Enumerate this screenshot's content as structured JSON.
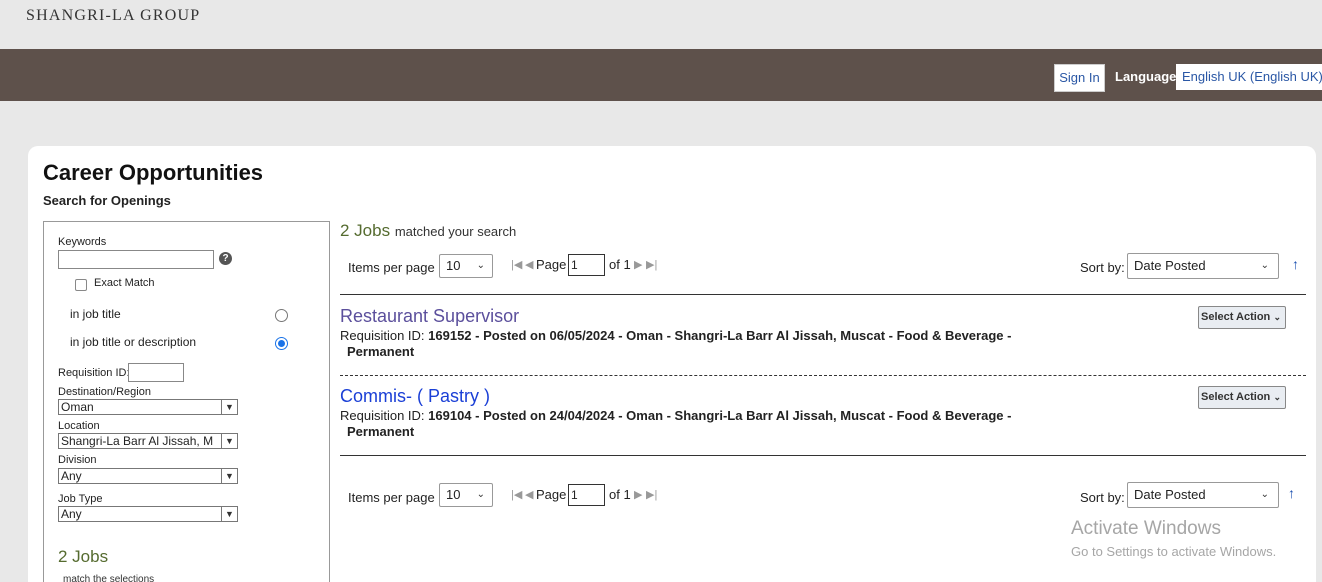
{
  "header": {
    "logo_text": "SHANGRI-LA GROUP",
    "sign_in_label": "Sign In",
    "language_label": "Language",
    "language_value": "English UK (English UK)"
  },
  "page": {
    "title": "Career Opportunities",
    "subtitle": "Search for Openings"
  },
  "filters": {
    "keywords_label": "Keywords",
    "keywords_value": "",
    "exact_match_label": "Exact Match",
    "in_job_title_label": "in job title",
    "in_job_title_or_description_label": "in job title or description",
    "requisition_id_label": "Requisition ID:",
    "requisition_id_value": "",
    "destination_label": "Destination/Region",
    "destination_value": "Oman",
    "location_label": "Location",
    "location_value": "Shangri-La Barr Al Jissah, M",
    "division_label": "Division",
    "division_value": "Any",
    "job_type_label": "Job Type",
    "job_type_value": "Any",
    "count_text": "2 Jobs",
    "count_sub": "match the selections"
  },
  "results": {
    "count_number": "2 Jobs",
    "count_suffix": "matched your search",
    "items_per_page_label": "Items per page",
    "items_per_page_value": "10",
    "page_label": "Page",
    "page_value": "1",
    "page_of": "of 1",
    "sort_label": "Sort by:",
    "sort_value": "Date Posted",
    "jobs": [
      {
        "title": "Restaurant Supervisor",
        "title_color": "#5b4f9c",
        "req_prefix": "Requisition ID: ",
        "req_id": "169152",
        "posted": " - Posted on 06/05/2024 - Oman  -  Shangri-La Barr Al Jissah, Muscat  -  Food & Beverage  -",
        "type": "Permanent",
        "action_label": "Select Action"
      },
      {
        "title": "Commis- ( Pastry )",
        "title_color": "#1a3fd6",
        "req_prefix": "Requisition ID: ",
        "req_id": "169104",
        "posted": " - Posted on 24/04/2024 - Oman  -  Shangri-La Barr Al Jissah, Muscat  -  Food & Beverage  -",
        "type": "Permanent",
        "action_label": "Select Action"
      }
    ]
  },
  "watermark": {
    "line1": "Activate Windows",
    "line2": "Go to Settings to activate Windows."
  }
}
